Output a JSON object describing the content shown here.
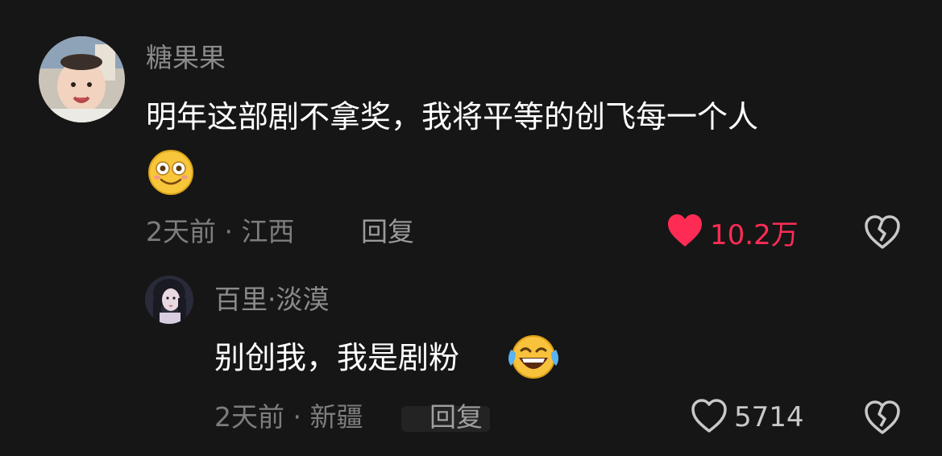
{
  "comment": {
    "username": "糖果果",
    "text": "明年这部剧不拿奖，我将平等的创飞每一个人",
    "emoji_icon": "slightly-smiling-face-emoji-icon",
    "time": "2天前",
    "location": "江西",
    "reply_label": "回复",
    "like_count": "10.2万",
    "like_color": "#fe2c55",
    "liked": true
  },
  "reply": {
    "username": "百里·淡漠",
    "text": "别创我，我是剧粉",
    "emoji_icon": "tears-of-joy-emoji-icon",
    "time": "2天前",
    "location": "新疆",
    "reply_label": "回复",
    "like_count": "5714",
    "liked": false
  },
  "meta_separator": "·"
}
